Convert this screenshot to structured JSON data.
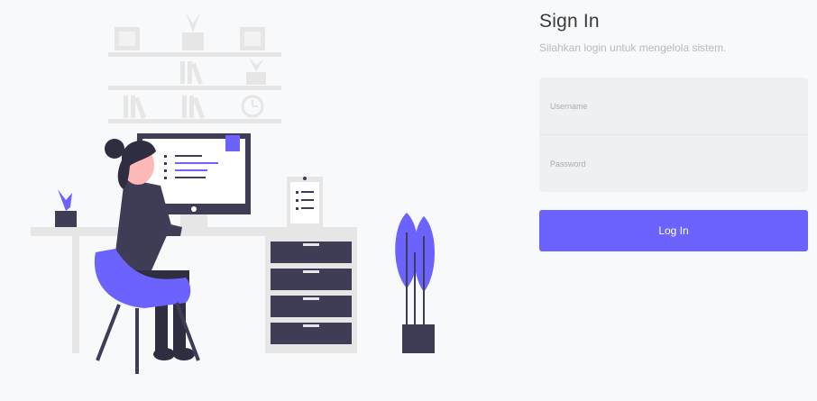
{
  "login": {
    "title": "Sign In",
    "subtitle": "Silahkan login untuk mengelola sistem.",
    "username_placeholder": "Username",
    "password_placeholder": "Password",
    "login_button": "Log In"
  },
  "colors": {
    "accent": "#6c63ff",
    "dark": "#3f3d56",
    "background": "#f8f9fb"
  },
  "icons": [
    "work-desk-illustration"
  ]
}
